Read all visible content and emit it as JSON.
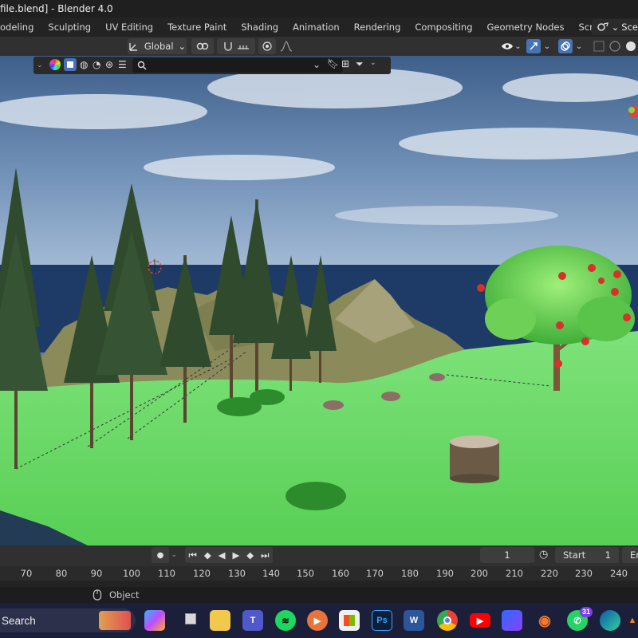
{
  "window": {
    "title": "file.blend] - Blender 4.0"
  },
  "workspaces": [
    {
      "label": "odeling"
    },
    {
      "label": "Sculpting"
    },
    {
      "label": "UV Editing"
    },
    {
      "label": "Texture Paint"
    },
    {
      "label": "Shading"
    },
    {
      "label": "Animation"
    },
    {
      "label": "Rendering"
    },
    {
      "label": "Compositing"
    },
    {
      "label": "Geometry Nodes"
    },
    {
      "label": "Scripting"
    }
  ],
  "workspace_add": "+",
  "scene_selector": {
    "label": "Sce"
  },
  "header": {
    "orientation": "Global"
  },
  "filter": {
    "search_value": ""
  },
  "timeline": {
    "current_frame": "1",
    "start_label": "Start",
    "start_value": "1",
    "end_label": "Er",
    "ticks": [
      "70",
      "80",
      "90",
      "100",
      "110",
      "120",
      "130",
      "140",
      "150",
      "160",
      "170",
      "180",
      "190",
      "200",
      "210",
      "220",
      "230",
      "240"
    ]
  },
  "status": {
    "mode": "Object"
  },
  "taskbar": {
    "search_label": "Search",
    "whatsapp_badge": "31",
    "apps": [
      "copilot-app",
      "task-view",
      "file-explorer",
      "teams",
      "spotify",
      "media-player",
      "microsoft-store",
      "photoshop",
      "word",
      "chrome",
      "youtube",
      "power-automate",
      "blender",
      "whatsapp",
      "edge",
      "vlc"
    ]
  },
  "colors": {
    "accent": "#4772b3",
    "grass": "#5fd65b",
    "sky": "#5b7fa6",
    "ocean": "#1e3a66",
    "taskbar": "#1b1f3a"
  }
}
